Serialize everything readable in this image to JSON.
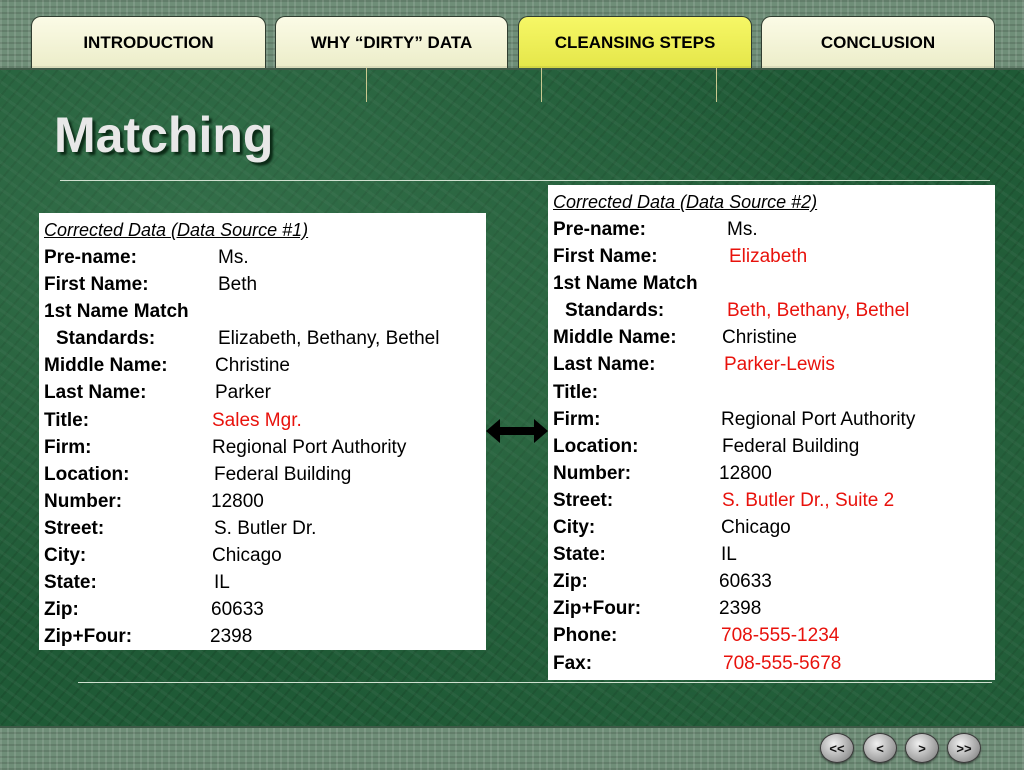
{
  "tabs": [
    {
      "label": "INTRODUCTION",
      "active": false
    },
    {
      "label": "WHY “DIRTY” DATA",
      "active": false
    },
    {
      "label": "CLEANSING STEPS",
      "active": true
    },
    {
      "label": "CONCLUSION",
      "active": false
    }
  ],
  "title": "Matching",
  "panel1": {
    "title": "Corrected Data (Data Source #1)",
    "rows": [
      {
        "label": "Pre-name:",
        "value": "Ms."
      },
      {
        "label": "First Name:",
        "value": "Beth"
      },
      {
        "label": "1st Name Match",
        "value": ""
      },
      {
        "label": "Standards:",
        "value": "Elizabeth, Bethany, Bethel"
      },
      {
        "label": "Middle Name:",
        "value": "Christine"
      },
      {
        "label": "Last Name:",
        "value": "Parker"
      },
      {
        "label": "Title:",
        "value": "Sales Mgr."
      },
      {
        "label": "Firm:",
        "value": "Regional Port Authority"
      },
      {
        "label": "Location:",
        "value": "Federal Building"
      },
      {
        "label": "Number:",
        "value": "12800"
      },
      {
        "label": "Street:",
        "value": "S. Butler Dr."
      },
      {
        "label": "City:",
        "value": "Chicago"
      },
      {
        "label": "State:",
        "value": "IL"
      },
      {
        "label": "Zip:",
        "value": "60633"
      },
      {
        "label": "Zip+Four:",
        "value": "2398"
      }
    ]
  },
  "panel2": {
    "title": "Corrected Data (Data Source #2)",
    "rows": [
      {
        "label": "Pre-name:",
        "value": "Ms."
      },
      {
        "label": "First Name:",
        "value": "Elizabeth"
      },
      {
        "label": "1st Name Match",
        "value": ""
      },
      {
        "label": "Standards:",
        "value": "Beth, Bethany, Bethel"
      },
      {
        "label": "Middle Name:",
        "value": "Christine"
      },
      {
        "label": "Last Name:",
        "value": "Parker-Lewis"
      },
      {
        "label": "Title:",
        "value": ""
      },
      {
        "label": "Firm:",
        "value": "Regional Port Authority"
      },
      {
        "label": "Location:",
        "value": "Federal Building"
      },
      {
        "label": "Number:",
        "value": "12800"
      },
      {
        "label": "Street:",
        "value": "S. Butler Dr., Suite 2"
      },
      {
        "label": "City:",
        "value": "Chicago"
      },
      {
        "label": "State:",
        "value": "IL"
      },
      {
        "label": "Zip:",
        "value": "60633"
      },
      {
        "label": "Zip+Four:",
        "value": "2398"
      },
      {
        "label": "Phone:",
        "value": "708-555-1234"
      },
      {
        "label": "Fax:",
        "value": "708-555-5678"
      }
    ]
  },
  "colors": {
    "highlight": "#e8120c",
    "active_tab": "#f0f15a",
    "background": "#1f5a36"
  },
  "icons": {
    "compare": "double-headed-arrow-icon"
  },
  "nav": {
    "first": "<<",
    "prev": "<",
    "next": ">",
    "last": ">>"
  }
}
